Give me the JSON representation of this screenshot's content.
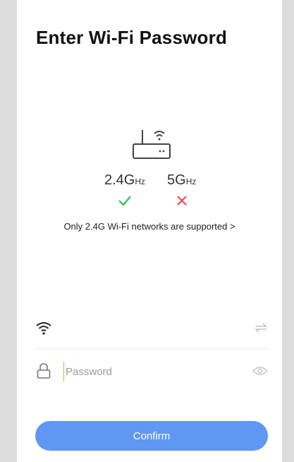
{
  "page": {
    "title": "Enter Wi-Fi Password"
  },
  "bands": {
    "band_24_value": "2.4G",
    "band_24_unit": "Hz",
    "band_5_value": "5G",
    "band_5_unit": "Hz"
  },
  "support_note": "Only 2.4G Wi-Fi networks are supported >",
  "wifi": {
    "ssid": ""
  },
  "password": {
    "placeholder": "Password",
    "value": ""
  },
  "confirm_label": "Confirm",
  "colors": {
    "accent": "#5f97f2",
    "ok": "#2ec24a",
    "no": "#f04a4a",
    "cursor": "#f0a03c"
  },
  "icons": [
    "router-icon",
    "check-icon",
    "cross-icon",
    "wifi-icon",
    "switch-network-icon",
    "lock-icon",
    "eye-icon"
  ]
}
